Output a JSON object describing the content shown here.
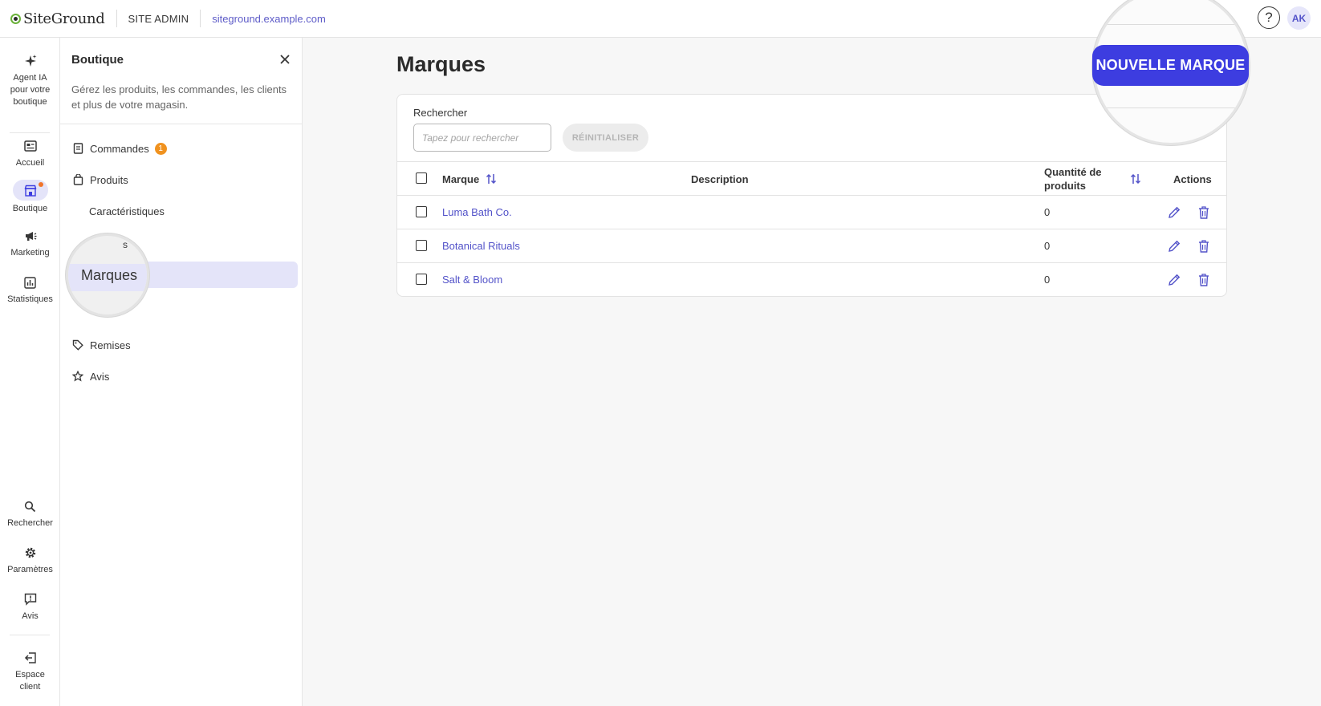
{
  "topbar": {
    "logo_text": "SiteGround",
    "section": "SITE ADMIN",
    "domain": "siteground.example.com",
    "help_glyph": "?",
    "avatar_initials": "AK"
  },
  "rail": {
    "items": [
      {
        "label": "Agent IA pour votre boutique",
        "icon": "sparkle-icon"
      },
      {
        "label": "Accueil",
        "icon": "dashboard-icon"
      },
      {
        "label": "Boutique",
        "icon": "store-icon"
      },
      {
        "label": "Marketing",
        "icon": "megaphone-icon"
      },
      {
        "label": "Statistiques",
        "icon": "chart-icon"
      },
      {
        "label": "Rechercher",
        "icon": "search-icon"
      },
      {
        "label": "Paramètres",
        "icon": "gear-icon"
      },
      {
        "label": "Avis",
        "icon": "feedback-icon"
      },
      {
        "label": "Espace client",
        "icon": "exit-icon"
      }
    ]
  },
  "panel": {
    "title": "Boutique",
    "description": "Gérez les produits, les commandes, les clients et plus de votre magasin.",
    "nav": [
      {
        "label": "Commandes",
        "badge": "1",
        "icon": "receipt-icon"
      },
      {
        "label": "Produits",
        "icon": "bag-icon"
      },
      {
        "label": "Caractéristiques"
      },
      {
        "label": "Marques",
        "active": true
      },
      {
        "label": "Remises",
        "icon": "tag-icon"
      },
      {
        "label": "Avis",
        "icon": "star-icon"
      }
    ],
    "magnifier_fragment": "s"
  },
  "main": {
    "title": "Marques",
    "new_button": "NOUVELLE MARQUE",
    "search": {
      "label": "Rechercher",
      "placeholder": "Tapez pour rechercher",
      "value": ""
    },
    "reset_button": "RÉINITIALISER",
    "columns": {
      "brand": "Marque",
      "description": "Description",
      "quantity": "Quantité de produits",
      "actions": "Actions"
    },
    "rows": [
      {
        "brand": "Luma Bath Co.",
        "description": "",
        "quantity": "0"
      },
      {
        "brand": "Botanical Rituals",
        "description": "",
        "quantity": "0"
      },
      {
        "brand": "Salt & Bloom",
        "description": "",
        "quantity": "0"
      }
    ]
  },
  "colors": {
    "accent": "#3d3de0",
    "link": "#5353c9",
    "badge": "#f0921f",
    "active_bg": "#e4e4f9"
  }
}
